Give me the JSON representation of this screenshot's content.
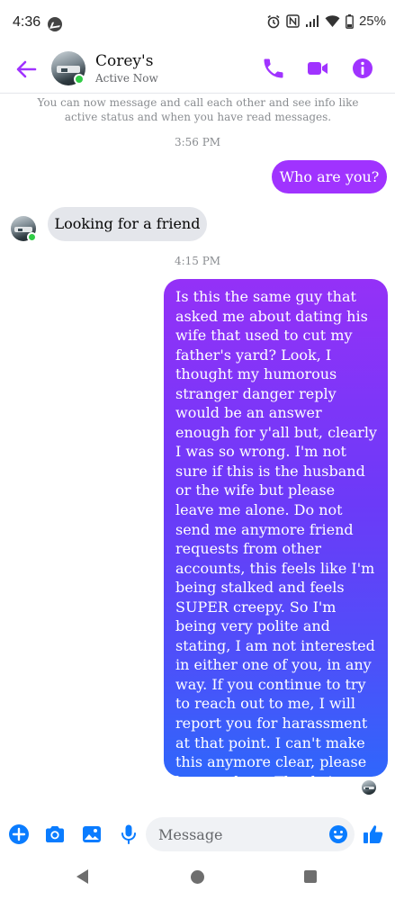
{
  "status_bar": {
    "time": "4:36",
    "battery": "25%",
    "icons": [
      "messenger-icon",
      "alarm-icon",
      "nfc-icon",
      "signal-icon",
      "wifi-icon",
      "battery-icon"
    ]
  },
  "header": {
    "contact_name": "Corey's",
    "contact_status": "Active Now",
    "icons": [
      "back-arrow-icon",
      "phone-icon",
      "video-icon",
      "info-icon"
    ],
    "accent_color": "#a033ff"
  },
  "thread": {
    "notice": "You can now message and call each other and see info like active status and when you have read messages.",
    "timestamp_1": "3:56 PM",
    "msg_out_1": "Who are you?",
    "msg_in_1": "Looking for a friend",
    "timestamp_2": "4:15 PM",
    "msg_out_2": "Is this the same guy that asked me about dating his wife that used to cut my father's yard? Look, I thought my humorous stranger danger reply would be an answer enough for y'all but, clearly I was so wrong. I'm not sure if this is the husband or the wife but please leave me alone. Do not send me anymore friend requests from other accounts, this feels like I'm being stalked and feels SUPER creepy. So I'm being very polite and stating, I am not interested in either one of you, in any way. If you continue to try to reach out to me, I will report you for harassment at that point. I can't make this anymore clear, please let me alone. Thanks!"
  },
  "composer": {
    "placeholder": "Message",
    "icons": [
      "plus-icon",
      "camera-icon",
      "gallery-icon",
      "mic-icon",
      "emoji-icon",
      "thumbs-up-icon"
    ],
    "accent_color": "#0a7cff"
  },
  "navbar": {
    "icons": [
      "nav-back-icon",
      "nav-home-icon",
      "nav-recents-icon"
    ]
  }
}
